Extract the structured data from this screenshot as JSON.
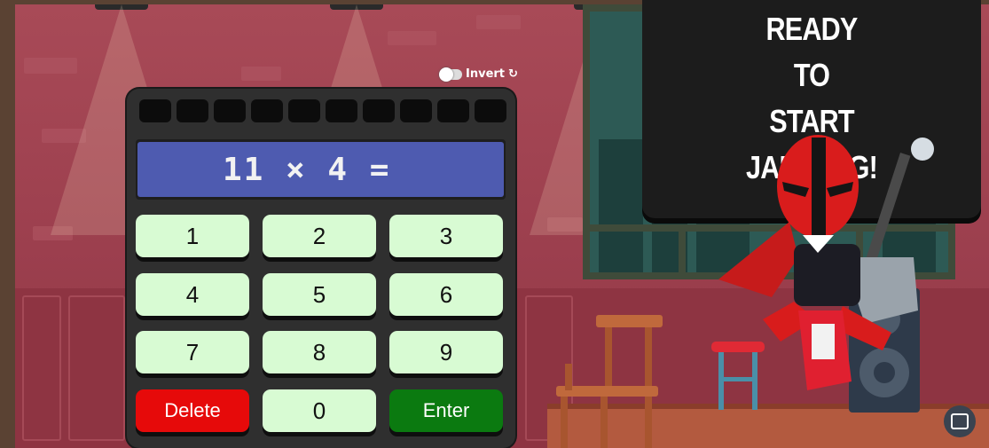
{
  "toggle": {
    "label": "Invert",
    "refresh_icon": "↻",
    "on": false
  },
  "calculator": {
    "progress_slots": 10,
    "question": "11 × 4 =",
    "keys": {
      "k1": "1",
      "k2": "2",
      "k3": "3",
      "k4": "4",
      "k5": "5",
      "k6": "6",
      "k7": "7",
      "k8": "8",
      "k9": "9",
      "delete": "Delete",
      "k0": "0",
      "enter": "Enter"
    },
    "colors": {
      "key": "#d8fbd3",
      "delete": "#e60a0a",
      "enter": "#0b7a10",
      "display": "#4e5bb0"
    }
  },
  "board": {
    "line1": "READY",
    "line2": "TO",
    "line3": "START",
    "line4": "JAMMING!"
  },
  "icons": {
    "help": "chat-icon",
    "character": "rocker-character",
    "guitar": "skull-guitar"
  }
}
